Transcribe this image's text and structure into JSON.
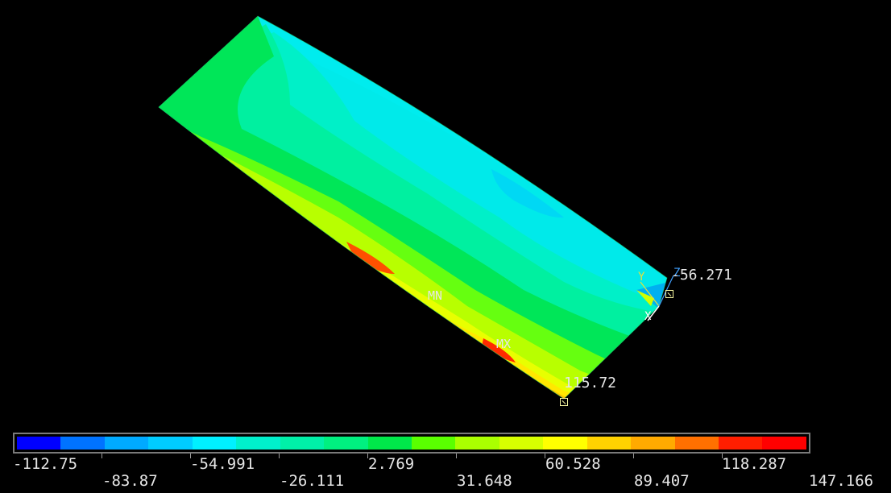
{
  "plot": {
    "min_marker_label": "MN",
    "max_marker_label": "MX",
    "node_value_top": "-56.271",
    "node_value_bottom": "115.72",
    "triad_labels": {
      "y": "Y",
      "z": "Z",
      "x": "X"
    },
    "band_colors": [
      "#00c84a",
      "#1ee055",
      "#00f080",
      "#00f0a8",
      "#00f0d0",
      "#00eeee",
      "#00d8ff",
      "#7fff00",
      "#c8ff00",
      "#ffff00",
      "#ffd200",
      "#ffaa00",
      "#ff7000",
      "#ff1e00"
    ]
  },
  "legend": {
    "colors": [
      "#0000ff",
      "#0073ff",
      "#00aaff",
      "#00ccff",
      "#00f0ff",
      "#00f0cc",
      "#00f0a8",
      "#00f080",
      "#00e84a",
      "#5aff00",
      "#aaff00",
      "#d7ff00",
      "#ffff00",
      "#ffd200",
      "#ffaa00",
      "#ff7000",
      "#ff1e00",
      "#ff0000"
    ],
    "ticks_top": [
      "-112.75",
      "-54.991",
      "2.769",
      "60.528",
      "118.287"
    ],
    "ticks_bottom": [
      "-83.87",
      "-26.111",
      "31.648",
      "89.407",
      "147.166"
    ]
  }
}
